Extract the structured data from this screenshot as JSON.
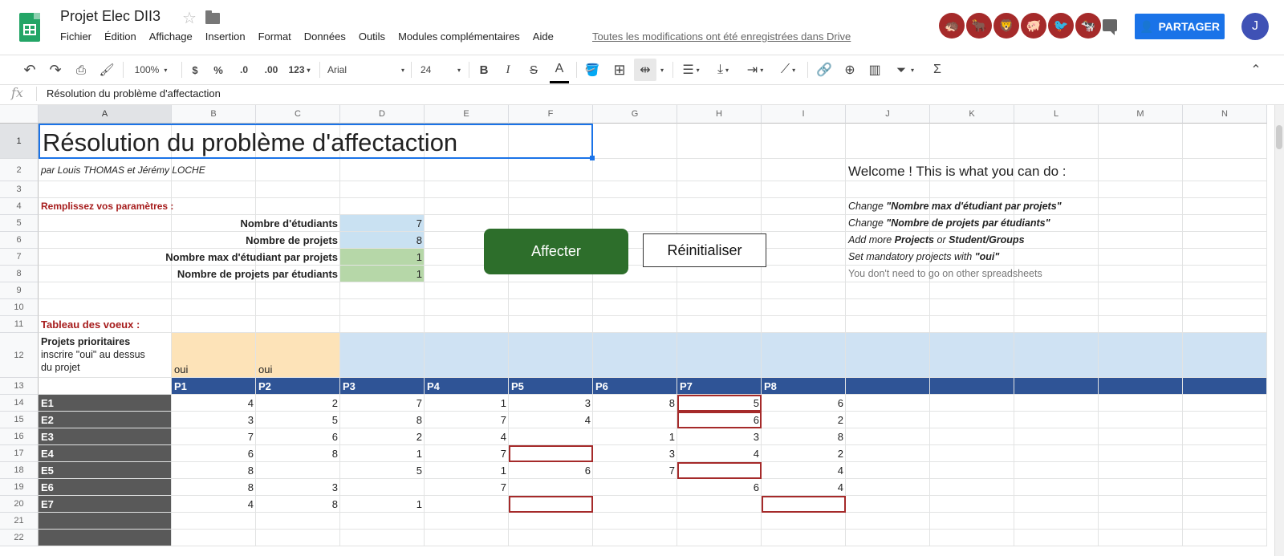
{
  "app": {
    "doc_title": "Projet Elec DII3",
    "menu": [
      "Fichier",
      "Édition",
      "Affichage",
      "Insertion",
      "Format",
      "Données",
      "Outils",
      "Modules complémentaires",
      "Aide"
    ],
    "save_status": "Toutes les modifications ont été enregistrées dans Drive",
    "share_label": "PARTAGER",
    "avatar_initial": "J",
    "addon_icons": [
      "hedgehog-icon",
      "bull-icon",
      "lion-icon",
      "pig-icon",
      "bird-icon",
      "cow-icon"
    ]
  },
  "toolbar": {
    "zoom": "100%",
    "currency": "$",
    "percent": "%",
    "dec_decrease": ".0",
    "dec_increase": ".00",
    "more_formats": "123",
    "font": "Arial",
    "font_size": "24",
    "bold": "B",
    "italic": "I",
    "strike": "S",
    "text_color": "A",
    "sum": "Σ"
  },
  "formula_bar": {
    "fx": "fx",
    "content": "Résolution du problème d'affectaction"
  },
  "columns": [
    "A",
    "B",
    "C",
    "D",
    "E",
    "F",
    "G",
    "H",
    "I",
    "J",
    "K",
    "L",
    "M",
    "N"
  ],
  "rows": [
    "1",
    "2",
    "3",
    "4",
    "5",
    "6",
    "7",
    "8",
    "9",
    "10",
    "11",
    "12",
    "13",
    "14",
    "15",
    "16",
    "17",
    "18",
    "19",
    "20",
    "21",
    "22"
  ],
  "sheet": {
    "title": "Résolution du problème d'affectaction",
    "authors": "par Louis THOMAS et Jérémy LOCHE",
    "params_title": "Remplissez vos paramètres :",
    "params": [
      {
        "label": "Nombre d'étudiants",
        "value": "7"
      },
      {
        "label": "Nombre de projets",
        "value": "8"
      },
      {
        "label": "Nombre max d'étudiant par projets",
        "value": "1"
      },
      {
        "label": "Nombre de projets par étudiants",
        "value": "1"
      }
    ],
    "wishes_title": "Tableau des voeux :",
    "priority_label": "Projets prioritaires",
    "priority_hint_1": "inscrire \"oui\" au dessus",
    "priority_hint_2": "du projet",
    "priority_b": "oui",
    "priority_c": "oui",
    "projects": [
      "P1",
      "P2",
      "P3",
      "P4",
      "P5",
      "P6",
      "P7",
      "P8"
    ],
    "students": [
      "E1",
      "E2",
      "E3",
      "E4",
      "E5",
      "E6",
      "E7"
    ],
    "values": [
      [
        "4",
        "2",
        "7",
        "1",
        "3",
        "8",
        "5",
        "6"
      ],
      [
        "3",
        "5",
        "8",
        "7",
        "4",
        "",
        "6",
        "2"
      ],
      [
        "7",
        "6",
        "2",
        "4",
        "",
        "1",
        "3",
        "8"
      ],
      [
        "6",
        "8",
        "1",
        "7",
        "",
        "3",
        "4",
        "2"
      ],
      [
        "8",
        "",
        "5",
        "1",
        "6",
        "7",
        "",
        "4"
      ],
      [
        "8",
        "3",
        "",
        "7",
        "",
        "",
        "6",
        "4"
      ],
      [
        "4",
        "8",
        "1",
        "",
        "",
        "",
        "",
        ""
      ]
    ],
    "affecter_label": "Affecter",
    "reset_label": "Réinitialiser",
    "welcome_title": "Welcome ! This is what you can do :",
    "help_1_a": "Change ",
    "help_1_b": "\"Nombre max d'étudiant par projets\"",
    "help_2_a": "Change ",
    "help_2_b": "\"Nombre de projets par étudiants\"",
    "help_3_a": "Add more ",
    "help_3_b": "Projects",
    "help_3_c": " or ",
    "help_3_d": "Student/Groups",
    "help_4_a": "Set mandatory projects with ",
    "help_4_b": "\"oui\"",
    "help_5": "You don't need to go on other spreadsheets"
  },
  "colors": {
    "header_blue": "#2f5496",
    "param_blue": "#c9e1f2",
    "param_green": "#b6d7a8",
    "priority_orange": "#fde3b8",
    "priority_blue": "#cfe2f3",
    "student_gray": "#595959",
    "accent_red": "#a52a2a",
    "share_blue": "#1a73e8"
  }
}
